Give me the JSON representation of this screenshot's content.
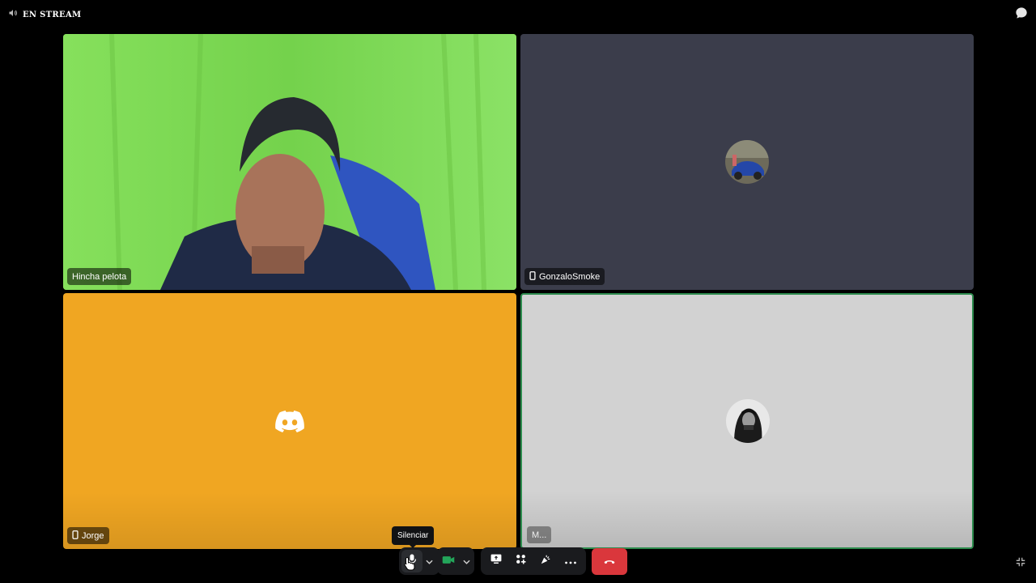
{
  "topbar": {
    "stream_label": "EN STREAM",
    "left_icon": "speaker-icon",
    "right_icon": "chat-bubble-icon"
  },
  "tiles": [
    {
      "name": "Hincha pelota",
      "type": "video",
      "mobile": false
    },
    {
      "name": "GonzaloSmoke",
      "type": "avatar",
      "mobile": true
    },
    {
      "name": "Jorge",
      "type": "discord-default",
      "mobile": true,
      "color": "#f0a622"
    },
    {
      "name": "M...",
      "type": "avatar",
      "mobile": false,
      "speaking": true
    }
  ],
  "tooltip": {
    "text": "Silenciar"
  },
  "controls": {
    "mic_icon": "microphone-icon",
    "camera_icon": "camera-icon",
    "screenshare_icon": "screen-share-icon",
    "activities_icon": "activities-icon",
    "soundboard_icon": "soundboard-icon",
    "more_icon": "more-icon",
    "hangup_icon": "hang-up-icon",
    "collapse_icon": "collapse-icon"
  },
  "colors": {
    "hangup": "#da373c",
    "camera_active": "#23a55a",
    "speaking_border": "#2d8c4e"
  }
}
